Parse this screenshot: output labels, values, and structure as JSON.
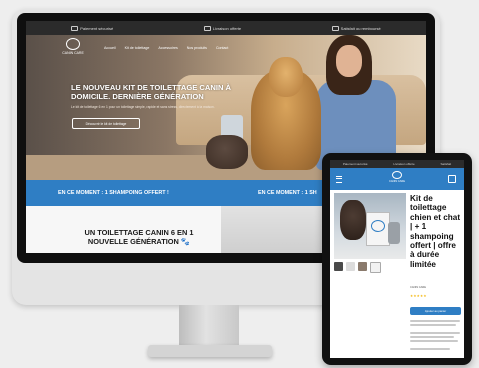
{
  "desktop": {
    "topbar": [
      {
        "icon": "truck-icon",
        "label": "Paiement sécurisé"
      },
      {
        "icon": "gift-icon",
        "label": "Livraison offerte"
      },
      {
        "icon": "shield-icon",
        "label": "Satisfait ou remboursé"
      }
    ],
    "logo_text": "CANIN CARE",
    "nav": [
      "Accueil",
      "Kit de toilettage",
      "Accessoires",
      "Nos produits",
      "Contact"
    ],
    "hero": {
      "title": "LE NOUVEAU KIT DE TOILETTAGE CANIN À DOMICILE. DERNIÈRE GÉNÉRATION",
      "subtitle": "Le kit de toilettage 6 en 1 pour un toilettage simple, rapide et sans stress, directement à la maison.",
      "button": "Découvrir le kit de toilettage"
    },
    "promo": [
      "EN CE MOMENT : 1 SHAMPOING OFFERT !",
      "EN CE MOMENT : 1 SH"
    ],
    "section_title": "UN TOILETTAGE CANIN 6 EN 1 NOUVELLE GÉNÉRATION 🐾"
  },
  "tablet": {
    "topbar": [
      "Paiement sécurisé",
      "Livraison offerte",
      "Satisfait"
    ],
    "logo_text": "CANIN CARE",
    "product_title": "Kit de toilettage chien et chat | + 1 shampoing offert | offre à durée limitée",
    "meta": "CANIN CARE",
    "stars": "★★★★★",
    "add_button": "Ajouter au panier"
  },
  "colors": {
    "brand_blue": "#2f7ec4",
    "topbar_dark": "#2b2b2b"
  }
}
